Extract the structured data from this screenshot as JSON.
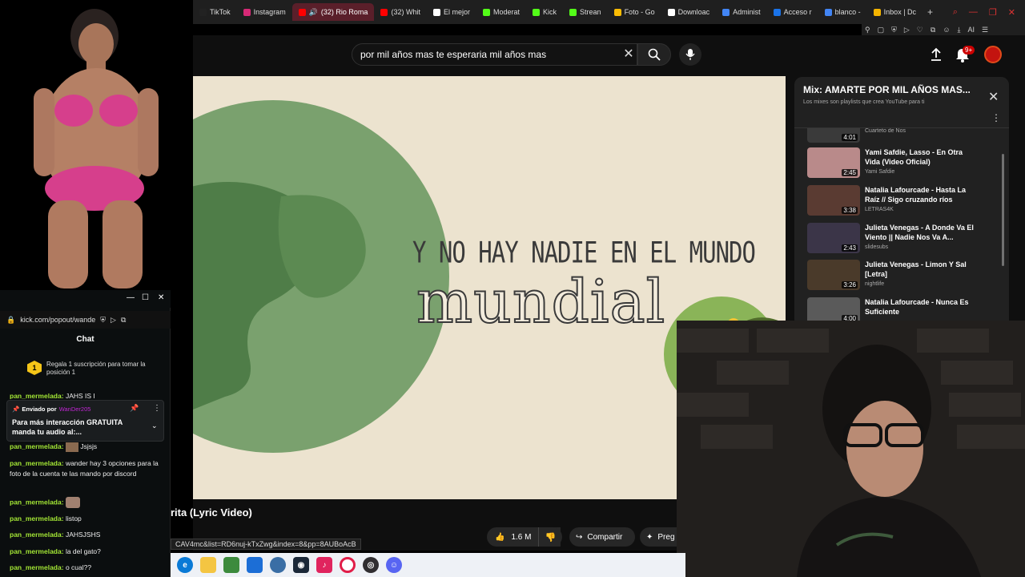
{
  "browser": {
    "tabs": [
      {
        "label": "TikTok",
        "color": "#222222"
      },
      {
        "label": "Instagram",
        "color": "#d62976"
      },
      {
        "label": "(32) Rio Roma",
        "color": "#ff0000",
        "active": true
      },
      {
        "label": "(32) Whit",
        "color": "#ff0000"
      },
      {
        "label": "El mejor",
        "color": "#ffffff"
      },
      {
        "label": "Moderat",
        "color": "#53fc18"
      },
      {
        "label": "Kick",
        "color": "#53fc18"
      },
      {
        "label": "Strean",
        "color": "#53fc18"
      },
      {
        "label": "Foto - Go",
        "color": "#fbbc04"
      },
      {
        "label": "Downloac",
        "color": "#ffffff"
      },
      {
        "label": "Administ",
        "color": "#4285f4"
      },
      {
        "label": "Acceso r",
        "color": "#1a73e8"
      },
      {
        "label": "blanco - ",
        "color": "#4285f4"
      },
      {
        "label": "Inbox | Dc",
        "color": "#f4b400"
      }
    ],
    "new_tab": "+",
    "toolbar_ai": "AI"
  },
  "youtube": {
    "search_query": "por mil años mas te esperaria mil años mas",
    "notif_count": "9+",
    "lyric_line_1": "Y NO HAY NADIE EN EL MUNDO",
    "lyric_line_2": "mundial",
    "video_title": "rita (Lyric Video)",
    "likes": "1.6 M",
    "share_label": "Compartir",
    "ask_label": "Preg",
    "status_url": "CAV4mc&list=RD6nuj-kTxZwg&index=8&pp=8AUBoAcB"
  },
  "playlist": {
    "title": "Mix: AMARTE POR MIL AÑOS MAS...",
    "subtitle": "Los mixes son playlists que crea YouTube para ti",
    "items": [
      {
        "name": "",
        "channel": "Cuarteto de Nos",
        "duration": "4:01",
        "thumb": "#3a3a3a"
      },
      {
        "name": "Yami Safdie, Lasso - En Otra Vida (Video Oficial)",
        "channel": "Yami Safdie",
        "duration": "2:45",
        "thumb": "#b98a8a"
      },
      {
        "name": "Natalia Lafourcade - Hasta La Raíz // Sigo cruzando ríos",
        "channel": "LETRAS4K",
        "duration": "3:38",
        "thumb": "#5a3b32"
      },
      {
        "name": "Julieta Venegas - A Donde Va El Viento || Nadie Nos Va A...",
        "channel": "slidesubs",
        "duration": "2:43",
        "thumb": "#3b3548"
      },
      {
        "name": "Julieta Venegas - Limon Y Sal [Letra]",
        "channel": "nightlife",
        "duration": "3:26",
        "thumb": "#4a3a2a"
      },
      {
        "name": "Natalia Lafourcade - Nunca Es Suficiente",
        "channel": "",
        "duration": "4:00",
        "thumb": "#5a5a5a"
      }
    ]
  },
  "chat": {
    "url": "kick.com/popout/wande",
    "heading": "Chat",
    "sub_rank": "1",
    "sub_promo": "Regala 1 suscripción para tomar la posición 1",
    "peek_user": "pan_mermelada:",
    "peek_text": "JAHS IS I",
    "pinned_label": "Enviado por",
    "pinned_user": "WanDer205",
    "pinned_text": "Para más interacción GRATUITA manda tu audio al:...",
    "messages": [
      {
        "user": "pan_mermelada:",
        "text": "Jsjsjs"
      },
      {
        "user": "pan_mermelada:",
        "text": "wander hay 3 opciones para la foto de la cuenta te las mando por discord"
      },
      {
        "user": "pan_mermelada:",
        "text": ""
      },
      {
        "user": "pan_mermelada:",
        "text": "listop"
      },
      {
        "user": "pan_mermelada:",
        "text": "JAHSJSHS"
      },
      {
        "user": "pan_mermelada:",
        "text": "la del gato?"
      },
      {
        "user": "pan_mermelada:",
        "text": "o cual??"
      }
    ]
  }
}
